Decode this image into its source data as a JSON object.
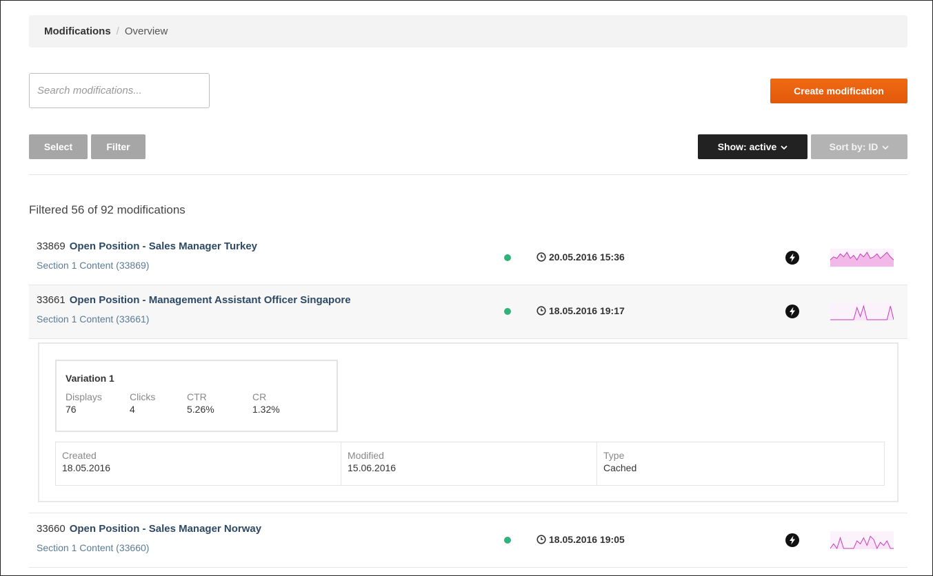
{
  "breadcrumb": {
    "current": "Modifications",
    "separator": "/",
    "sub": "Overview"
  },
  "search": {
    "placeholder": "Search modifications...",
    "value": ""
  },
  "toolbar": {
    "create_label": "Create modification",
    "select_label": "Select",
    "filter_label": "Filter",
    "show_label": "Show: active",
    "sort_label": "Sort by: ID"
  },
  "summary": {
    "text": "Filtered 56 of 92 modifications"
  },
  "rows": [
    {
      "id": "33869",
      "name": "Open Position - Sales Manager Turkey",
      "section": "Section 1 Content (33869)",
      "timestamp": "20.05.2016 15:36",
      "status_color": "#2fb37a",
      "spark_fill": "#f2b8e8",
      "spark_line": "#c53fb7",
      "spark": [
        0.4,
        0.6,
        0.5,
        0.8,
        0.6,
        0.9,
        0.5,
        0.7,
        0.4,
        0.8,
        0.6,
        0.9,
        0.5,
        0.6,
        0.8,
        0.5,
        0.7,
        0.9,
        0.6,
        0.4
      ]
    },
    {
      "id": "33661",
      "name": "Open Position - Management Assistant Officer Singapore",
      "section": "Section 1 Content (33661)",
      "timestamp": "18.05.2016 19:17",
      "status_color": "#2fb37a",
      "spark_fill": "#fbe3f8",
      "spark_line": "#c53fb7",
      "spark": [
        0,
        0,
        0,
        0,
        0,
        0,
        0,
        0,
        0.8,
        0.2,
        0.9,
        0,
        0,
        0,
        0,
        0,
        0,
        0,
        0.9,
        0
      ]
    },
    {
      "id": "33660",
      "name": "Open Position - Sales Manager Norway",
      "section": "Section 1 Content (33660)",
      "timestamp": "18.05.2016 19:05",
      "status_color": "#2fb37a",
      "spark_fill": "#fbe3f8",
      "spark_line": "#c53fb7",
      "spark": [
        0,
        0.3,
        0,
        0.7,
        0,
        0,
        0,
        0,
        0.5,
        0.3,
        0.7,
        0.2,
        0.8,
        0.6,
        0,
        0.4,
        0.2,
        0.5,
        0,
        0
      ]
    }
  ],
  "expanded": {
    "variation": {
      "title": "Variation 1",
      "metrics": [
        {
          "label": "Displays",
          "value": "76"
        },
        {
          "label": "Clicks",
          "value": "4"
        },
        {
          "label": "CTR",
          "value": "5.26%"
        },
        {
          "label": "CR",
          "value": "1.32%"
        }
      ]
    },
    "meta": [
      {
        "label": "Created",
        "value": "18.05.2016"
      },
      {
        "label": "Modified",
        "value": "15.06.2016"
      },
      {
        "label": "Type",
        "value": "Cached"
      }
    ]
  }
}
